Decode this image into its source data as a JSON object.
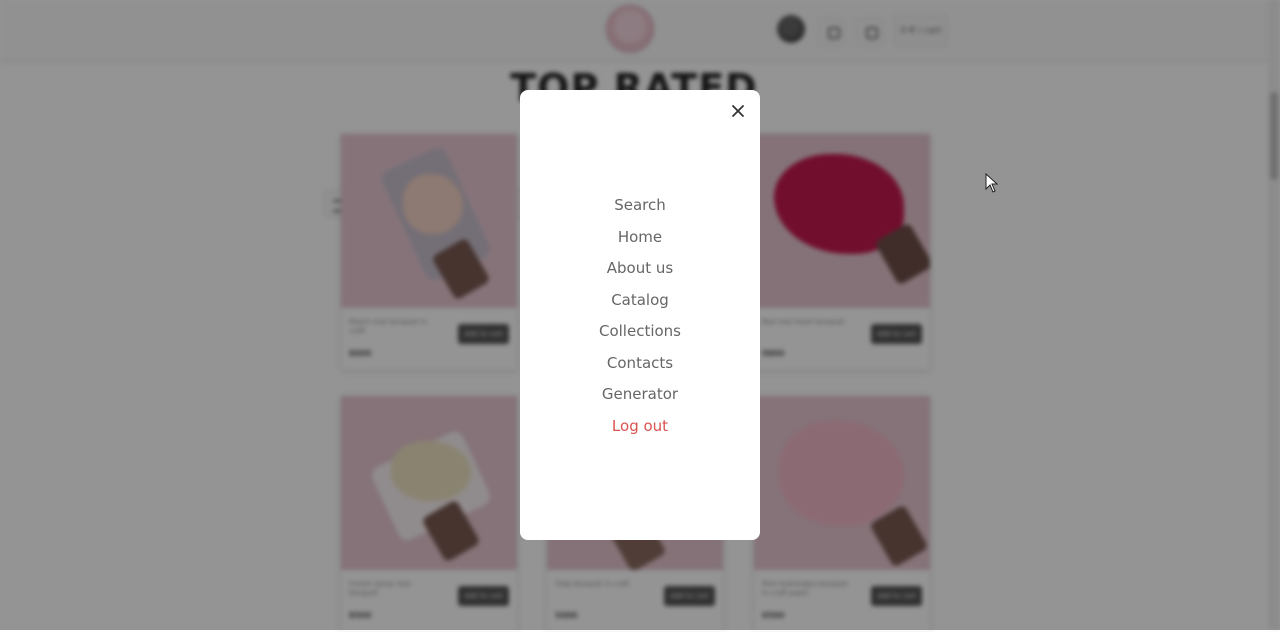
{
  "header": {
    "cart_label": "0 ₽ / cart"
  },
  "page": {
    "heading": "TOP RATED"
  },
  "products": [
    {
      "name": "Peach rose bouquet in craft",
      "price": "8000",
      "button": "Add to cart"
    },
    {
      "name": "Red rose heart bouquet",
      "price": "9800",
      "button": "Add to cart"
    },
    {
      "name": "Cream spray rose bouquet",
      "price": "8500",
      "button": "Add to cart"
    },
    {
      "name": "Tulip bouquet in craft",
      "price": "5000",
      "button": "Add to cart"
    },
    {
      "name": "Pink hydrangea bouquet in craft paper",
      "price": "6500",
      "button": "Add to cart"
    }
  ],
  "menu": {
    "items": [
      {
        "label": "Search"
      },
      {
        "label": "Home"
      },
      {
        "label": "About us"
      },
      {
        "label": "Catalog"
      },
      {
        "label": "Collections"
      },
      {
        "label": "Contacts"
      },
      {
        "label": "Generator"
      },
      {
        "label": "Log out"
      }
    ],
    "logout_color": "#d9534f",
    "text_color": "#666666",
    "close_icon": "close-icon"
  }
}
